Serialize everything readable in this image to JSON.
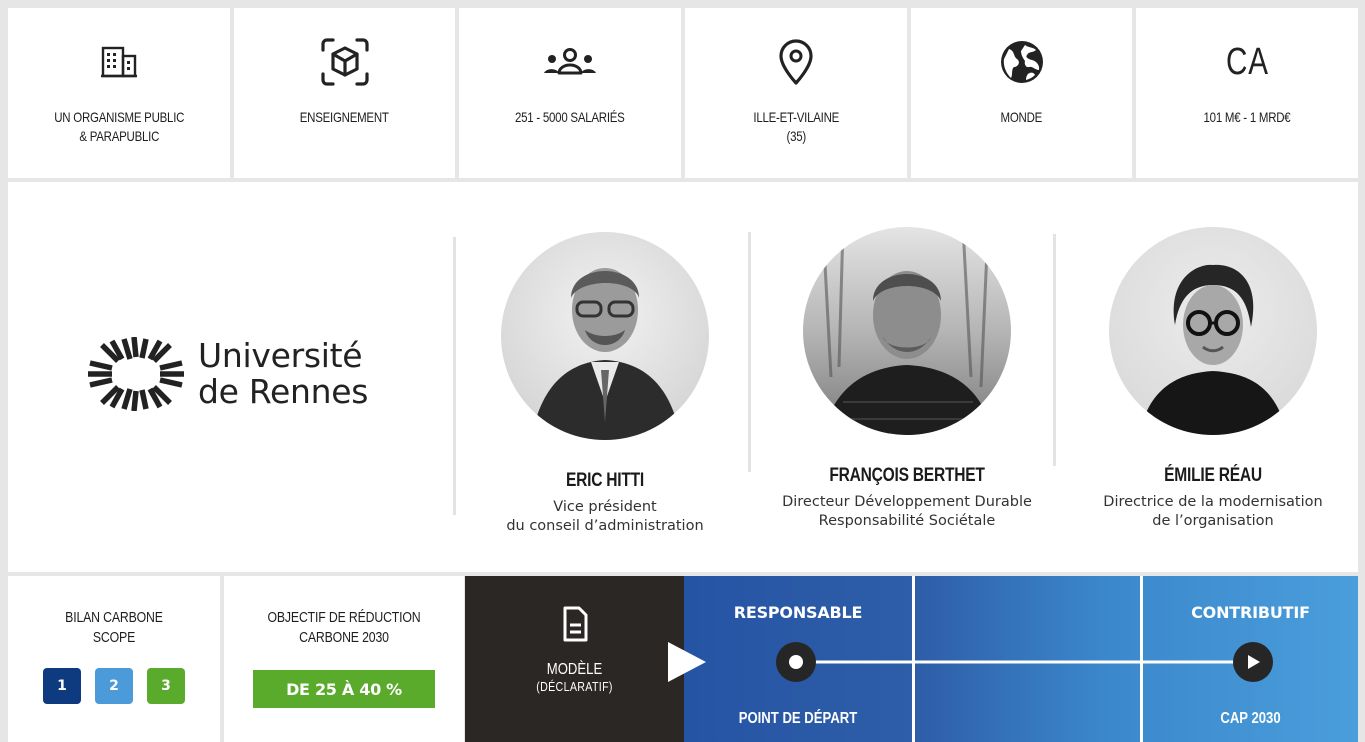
{
  "info_cards": [
    {
      "icon": "building-icon",
      "label": "UN ORGANISME PUBLIC\n& PARAPUBLIC"
    },
    {
      "icon": "cube-scan-icon",
      "label": "ENSEIGNEMENT"
    },
    {
      "icon": "people-icon",
      "label": "251 - 5000 SALARIÉS"
    },
    {
      "icon": "location-pin-icon",
      "label": "ILLE-ET-VILAINE\n(35)"
    },
    {
      "icon": "globe-icon",
      "label": "MONDE"
    },
    {
      "icon_text": "CA",
      "label": "101 M€ - 1 MRD€"
    }
  ],
  "organization": {
    "name_line1": "Université",
    "name_line2": "de Rennes"
  },
  "people": [
    {
      "name": "ERIC HITTI",
      "role": "Vice président\ndu conseil d’administration"
    },
    {
      "name": "FRANÇOIS BERTHET",
      "role": "Directeur Développement Durable\nResponsabilité Sociétale"
    },
    {
      "name": "ÉMILIE RÉAU",
      "role": "Directrice de la modernisation\nde l’organisation"
    }
  ],
  "bilan": {
    "title": "BILAN CARBONE\nSCOPE",
    "scopes": [
      "1",
      "2",
      "3"
    ]
  },
  "objectif": {
    "title": "OBJECTIF DE RÉDUCTION\nCARBONE  2030",
    "value": "DE 25 À 40 %"
  },
  "modele": {
    "label": "MODÈLE",
    "sublabel": "(DÉCLARATIF)"
  },
  "trajectory": {
    "start_header": "RESPONSABLE",
    "end_header": "CONTRIBUTIF",
    "start_footer": "POINT DE DÉPART",
    "end_footer": "CAP 2030"
  },
  "colors": {
    "scope1": "#0e3a7f",
    "scope2": "#4b9ad9",
    "scope3": "#5aaa2c",
    "model_bg": "#2b2724",
    "track_start": "#2654a5",
    "track_end": "#4a9edb"
  }
}
